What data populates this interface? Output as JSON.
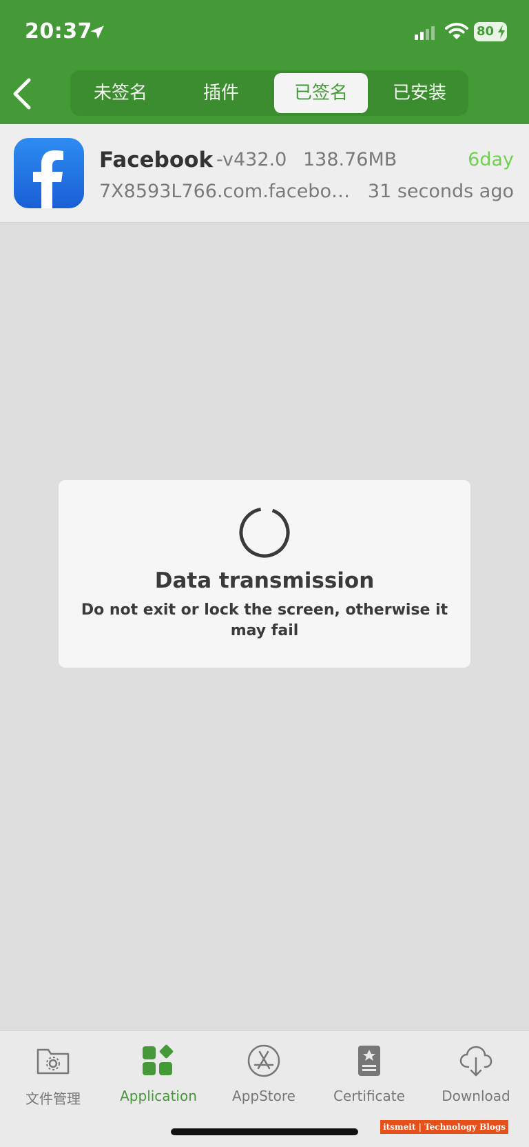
{
  "status_bar": {
    "time": "20:37",
    "battery": "80",
    "icons": [
      "location-arrow-icon",
      "cellular-signal-icon",
      "wifi-icon",
      "battery-charging-icon"
    ]
  },
  "header": {
    "back_icon": "chevron-left-icon",
    "tabs": [
      {
        "label": "未签名",
        "active": false
      },
      {
        "label": "插件",
        "active": false
      },
      {
        "label": "已签名",
        "active": true
      },
      {
        "label": "已安装",
        "active": false
      }
    ]
  },
  "app_list": [
    {
      "icon": "facebook-icon",
      "name": "Facebook",
      "version": "-v432.0",
      "size": "138.76MB",
      "days": "6day",
      "bundle_id": "7X8593L766.com.faceboo...",
      "time_ago": "31 seconds ago"
    }
  ],
  "dialog": {
    "icon": "spinner-icon",
    "title": "Data transmission",
    "message": "Do not exit or lock the screen, otherwise it may fail"
  },
  "tab_bar": {
    "items": [
      {
        "label": "文件管理",
        "icon": "folder-gear-icon",
        "active": false
      },
      {
        "label": "Application",
        "icon": "grid-apps-icon",
        "active": true
      },
      {
        "label": "AppStore",
        "icon": "appstore-icon",
        "active": false
      },
      {
        "label": "Certificate",
        "icon": "certificate-icon",
        "active": false
      },
      {
        "label": "Download",
        "icon": "cloud-download-icon",
        "active": false
      }
    ]
  },
  "watermark": "itsmeit | Technology Blogs",
  "colors": {
    "brand_green": "#449a37",
    "days_green": "#6ed24f",
    "background": "#dedede",
    "facebook_blue": "#1877f2"
  }
}
